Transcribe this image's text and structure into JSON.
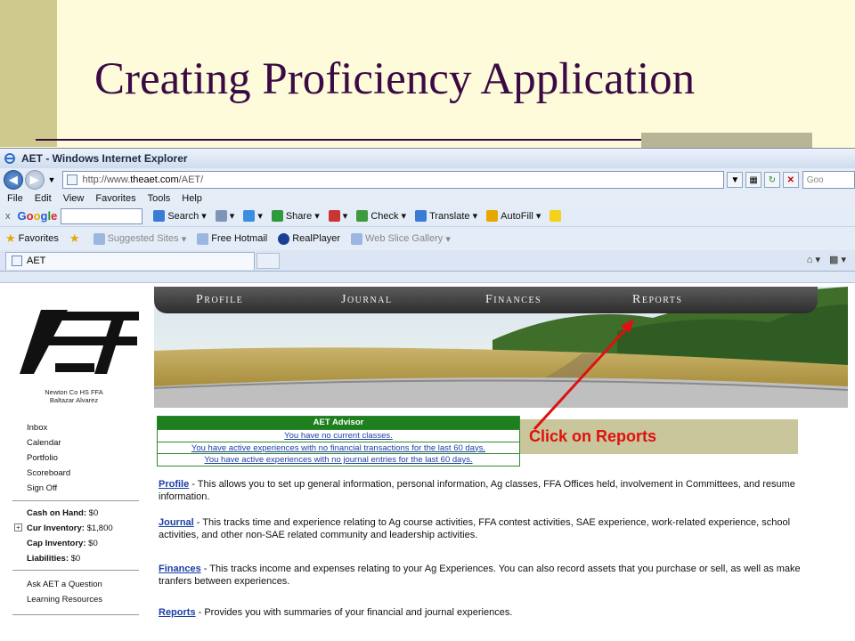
{
  "slide": {
    "title": "Creating Proficiency Application"
  },
  "browser": {
    "window_title": "AET - Windows Internet Explorer",
    "url_prefix": "http://www.",
    "url_domain": "theaet.com",
    "url_path": "/AET/",
    "search_hint": "Goo",
    "menu": [
      "File",
      "Edit",
      "View",
      "Favorites",
      "Tools",
      "Help"
    ],
    "google_toolbar": {
      "close": "x",
      "logo": "Google",
      "search_label": "Search",
      "share_label": "Share",
      "check_label": "Check",
      "translate_label": "Translate",
      "autofill_label": "AutoFill"
    },
    "favorites_bar": {
      "favorites_label": "Favorites",
      "suggested_sites": "Suggested Sites",
      "free_hotmail": "Free Hotmail",
      "realplayer": "RealPlayer",
      "web_slice_gallery": "Web Slice Gallery"
    },
    "tab_label": "AET"
  },
  "site": {
    "logo_text": "AET",
    "school": "Newton Co HS FFA",
    "student": "Baltazar Alvarez",
    "nav": [
      "Inbox",
      "Calendar",
      "Portfolio",
      "Scoreboard",
      "Sign Off"
    ],
    "finance": [
      {
        "label": "Cash on Hand:",
        "value": "$0"
      },
      {
        "label": "Cur Inventory:",
        "value": "$1,800"
      },
      {
        "label": "Cap Inventory:",
        "value": "$0"
      },
      {
        "label": "Liabilities:",
        "value": "$0"
      }
    ],
    "misc": [
      "Ask AET a Question",
      "Learning Resources"
    ],
    "banner_tabs": [
      "Profile",
      "Journal",
      "Finances",
      "Reports"
    ],
    "advisor": {
      "title": "AET Advisor",
      "rows": [
        "You have no current classes.",
        "You have active experiences with no financial transactions for the last 60 days.",
        "You have active experiences with no journal entries for the last 60 days."
      ]
    },
    "descriptions": [
      {
        "link": "Profile",
        "text": " - This allows you to set up general information, personal information, Ag classes, FFA Offices held, involvement in Committees, and resume information."
      },
      {
        "link": "Journal",
        "text": " - This tracks time and experience relating to Ag course activities, FFA contest activities, SAE experience, work-related experience, school activities, and other non-SAE related community and leadership activities."
      },
      {
        "link": "Finances",
        "text": " - This tracks income and expenses relating to your Ag Experiences.  You can also record assets that you purchase or sell, as well as make tranfers between experiences."
      },
      {
        "link": "Reports",
        "text": " - Provides you with summaries of your financial and journal experiences."
      }
    ]
  },
  "callout": {
    "text": "Click on Reports",
    "color": "#e01010"
  }
}
